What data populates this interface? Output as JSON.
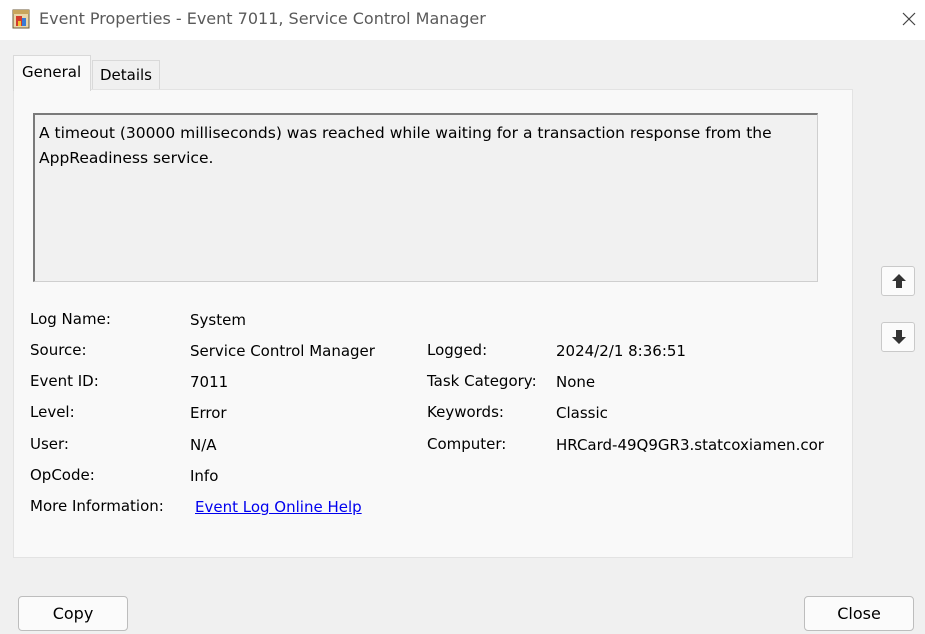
{
  "window": {
    "title": "Event Properties - Event 7011, Service Control Manager"
  },
  "tabs": [
    {
      "label": "General",
      "active": true
    },
    {
      "label": "Details",
      "active": false
    }
  ],
  "description": "A timeout (30000 milliseconds) was reached while waiting for a transaction response from the AppReadiness service.",
  "fields": {
    "log_name": {
      "label": "Log Name:",
      "value": "System"
    },
    "source": {
      "label": "Source:",
      "value": "Service Control Manager"
    },
    "event_id": {
      "label": "Event ID:",
      "value": "7011"
    },
    "level": {
      "label": "Level:",
      "value": "Error"
    },
    "user": {
      "label": "User:",
      "value": "N/A"
    },
    "opcode": {
      "label": "OpCode:",
      "value": "Info"
    },
    "more_info": {
      "label": "More Information:",
      "value": "Event Log Online Help"
    },
    "logged": {
      "label": "Logged:",
      "value": "2024/2/1 8:36:51"
    },
    "task_category": {
      "label": "Task Category:",
      "value": "None"
    },
    "keywords": {
      "label": "Keywords:",
      "value": "Classic"
    },
    "computer": {
      "label": "Computer:",
      "value": "HRCard-49Q9GR3.statcoxiamen.cor"
    }
  },
  "buttons": {
    "copy": "Copy",
    "close": "Close"
  },
  "icons": {
    "app": "event-properties-icon",
    "close": "close-icon",
    "up": "arrow-up-icon",
    "down": "arrow-down-icon"
  },
  "colors": {
    "link": "#0000ee",
    "background": "#f0f0f0"
  }
}
